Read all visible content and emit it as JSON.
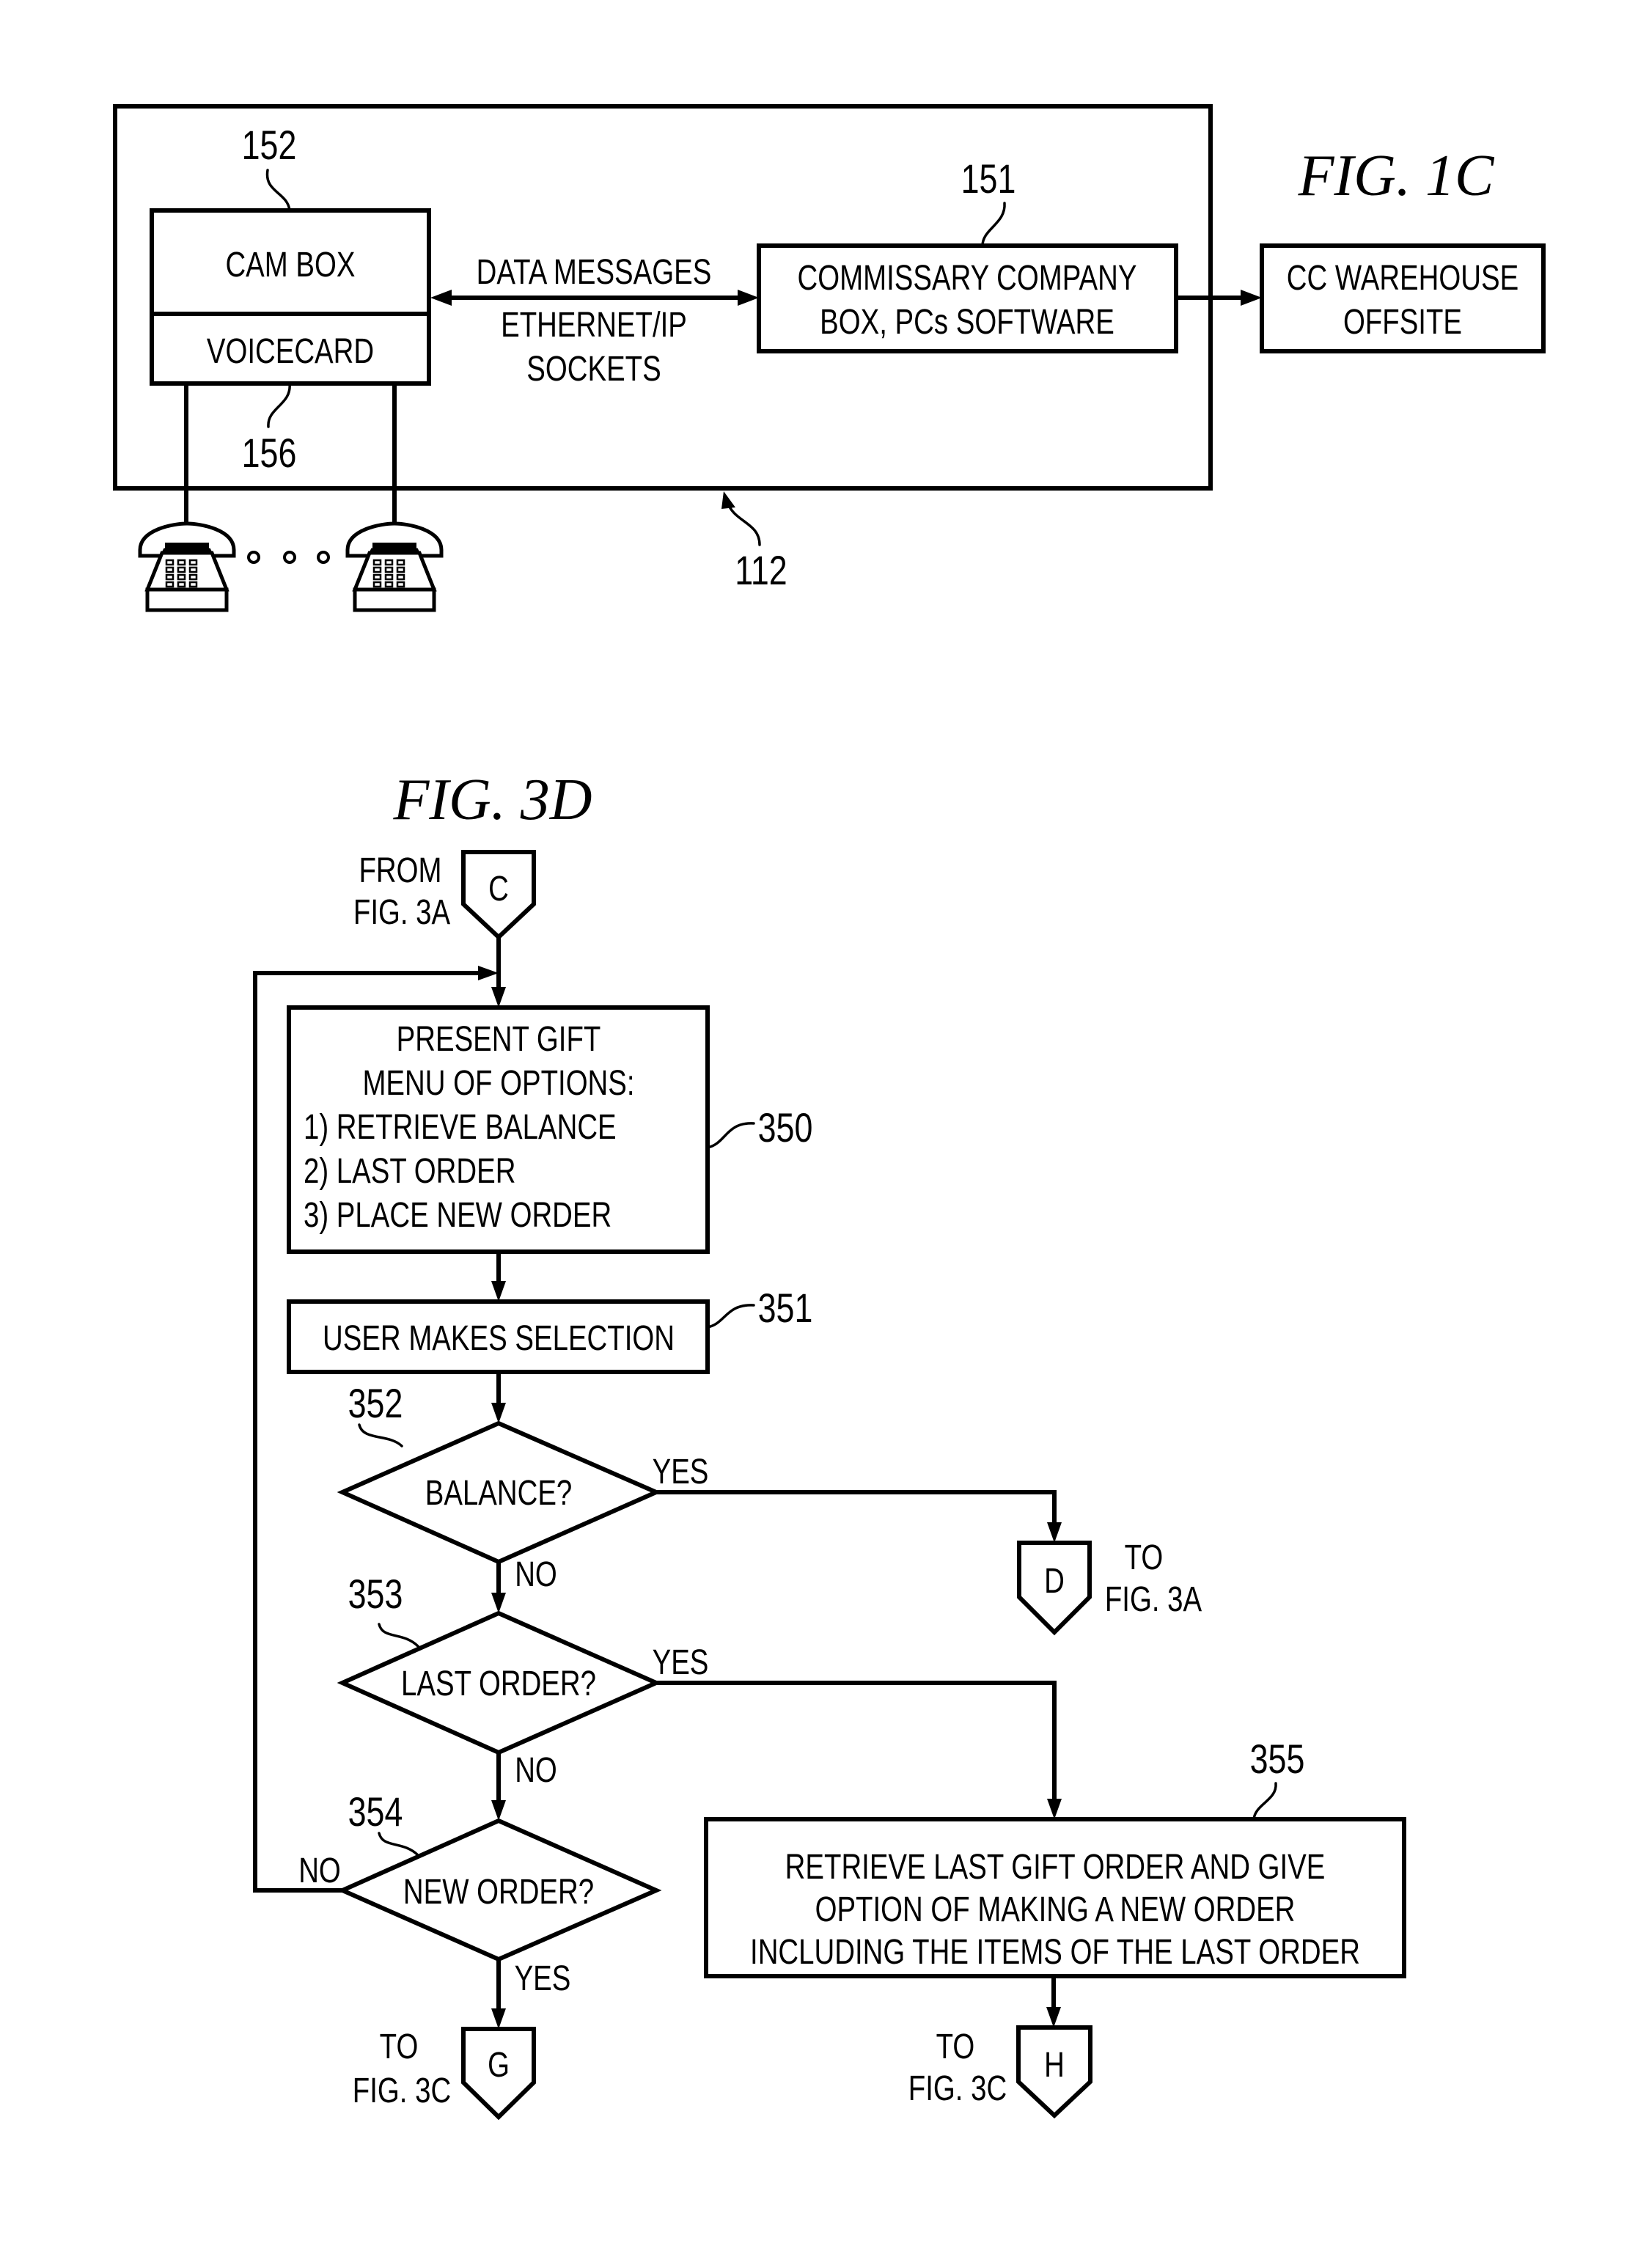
{
  "fig1c": {
    "title": "FIG. 1C",
    "system_ref": "112",
    "cam_box": {
      "ref": "152",
      "label": "CAM BOX"
    },
    "voicecard": {
      "ref": "156",
      "label": "VOICECARD"
    },
    "link": {
      "line1": "DATA MESSAGES",
      "line2": "ETHERNET/IP",
      "line3": "SOCKETS"
    },
    "commissary_box": {
      "ref": "151",
      "line1": "COMMISSARY COMPANY",
      "line2": "BOX, PCs SOFTWARE"
    },
    "warehouse_box": {
      "line1": "CC WAREHOUSE",
      "line2": "OFFSITE"
    },
    "phones": {
      "icon": "telephone-icon",
      "count_shown": 2,
      "ellipsis": "• • •"
    }
  },
  "fig3d": {
    "title": "FIG. 3D",
    "entry_connector": {
      "letter": "C",
      "note_line1": "FROM",
      "note_line2": "FIG. 3A"
    },
    "step_350": {
      "ref": "350",
      "lines": [
        "PRESENT GIFT",
        "MENU OF OPTIONS:",
        "1) RETRIEVE BALANCE",
        "2) LAST ORDER",
        "3) PLACE NEW ORDER"
      ]
    },
    "step_351": {
      "ref": "351",
      "label": "USER MAKES SELECTION"
    },
    "decision_352": {
      "ref": "352",
      "label": "BALANCE?",
      "yes": "YES",
      "no": "NO"
    },
    "decision_353": {
      "ref": "353",
      "label": "LAST ORDER?",
      "yes": "YES",
      "no": "NO"
    },
    "decision_354": {
      "ref": "354",
      "label": "NEW ORDER?",
      "yes": "YES",
      "no": "NO"
    },
    "step_355": {
      "ref": "355",
      "lines": [
        "RETRIEVE LAST GIFT ORDER AND GIVE",
        "OPTION OF MAKING A NEW ORDER",
        "INCLUDING THE ITEMS OF THE LAST ORDER"
      ]
    },
    "connector_d": {
      "letter": "D",
      "note_line1": "TO",
      "note_line2": "FIG. 3A"
    },
    "connector_g": {
      "letter": "G",
      "note_line1": "TO",
      "note_line2": "FIG. 3C"
    },
    "connector_h": {
      "letter": "H",
      "note_line1": "TO",
      "note_line2": "FIG. 3C"
    }
  }
}
